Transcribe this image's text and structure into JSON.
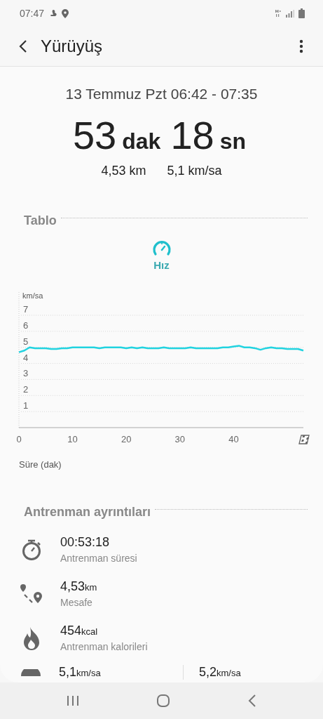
{
  "status_bar": {
    "time": "07:47"
  },
  "header": {
    "title": "Yürüyüş"
  },
  "summary": {
    "date_range": "13 Temmuz Pzt 06:42 - 07:35",
    "duration": [
      {
        "value": "53",
        "unit": "dak"
      },
      {
        "value": "18",
        "unit": "sn"
      }
    ],
    "stats": [
      "4,53 km",
      "5,1 km/sa"
    ]
  },
  "chart_section": {
    "title": "Tablo",
    "metric_tabs": [
      {
        "selected": true
      }
    ],
    "chart_data": {
      "type": "line",
      "ylabel": "km/sa",
      "xlabel": "Süre (dak)",
      "grid": true,
      "xlim": [
        0,
        53
      ],
      "ylim": [
        0,
        7
      ],
      "xticks": [
        0,
        10,
        20,
        30,
        40
      ],
      "yticks": [
        1,
        2,
        3,
        4,
        5,
        6,
        7
      ],
      "x": [
        0,
        1,
        2,
        3,
        4,
        5,
        6,
        7,
        8,
        9,
        10,
        11,
        12,
        13,
        14,
        15,
        16,
        17,
        18,
        19,
        20,
        21,
        22,
        23,
        24,
        25,
        26,
        27,
        28,
        29,
        30,
        31,
        32,
        33,
        34,
        35,
        36,
        37,
        38,
        39,
        40,
        41,
        42,
        43,
        44,
        45,
        46,
        47,
        48,
        49,
        50,
        51,
        52,
        53
      ],
      "series": [
        {
          "name": "Hız",
          "color": "#22d3e0",
          "values": [
            4.7,
            4.8,
            5.0,
            4.95,
            4.95,
            4.95,
            4.9,
            4.9,
            4.95,
            4.95,
            5.0,
            5.0,
            5.0,
            5.0,
            5.0,
            4.95,
            5.0,
            5.0,
            5.0,
            5.0,
            4.95,
            5.0,
            4.95,
            5.0,
            4.95,
            4.95,
            4.95,
            5.0,
            4.95,
            4.95,
            4.95,
            4.95,
            5.0,
            4.95,
            4.95,
            4.95,
            4.95,
            4.95,
            5.0,
            5.0,
            5.05,
            5.1,
            5.0,
            5.0,
            4.95,
            4.85,
            4.95,
            5.0,
            4.95,
            4.95,
            4.9,
            4.9,
            4.9,
            4.8
          ]
        }
      ]
    }
  },
  "details": {
    "title": "Antrenman ayrıntıları",
    "items": [
      {
        "kind": "time",
        "value": "00:53:18",
        "label": "Antrenman süresi"
      },
      {
        "kind": "distance",
        "value": "4,53",
        "unit": "km",
        "label": "Mesafe"
      },
      {
        "kind": "calories",
        "value": "454",
        "unit": "kcal",
        "label": "Antrenman kalorileri"
      },
      {
        "kind": "speed",
        "values": [
          {
            "value": "5,1",
            "unit": "km/sa"
          },
          {
            "value": "5,2",
            "unit": "km/sa"
          }
        ]
      }
    ]
  }
}
